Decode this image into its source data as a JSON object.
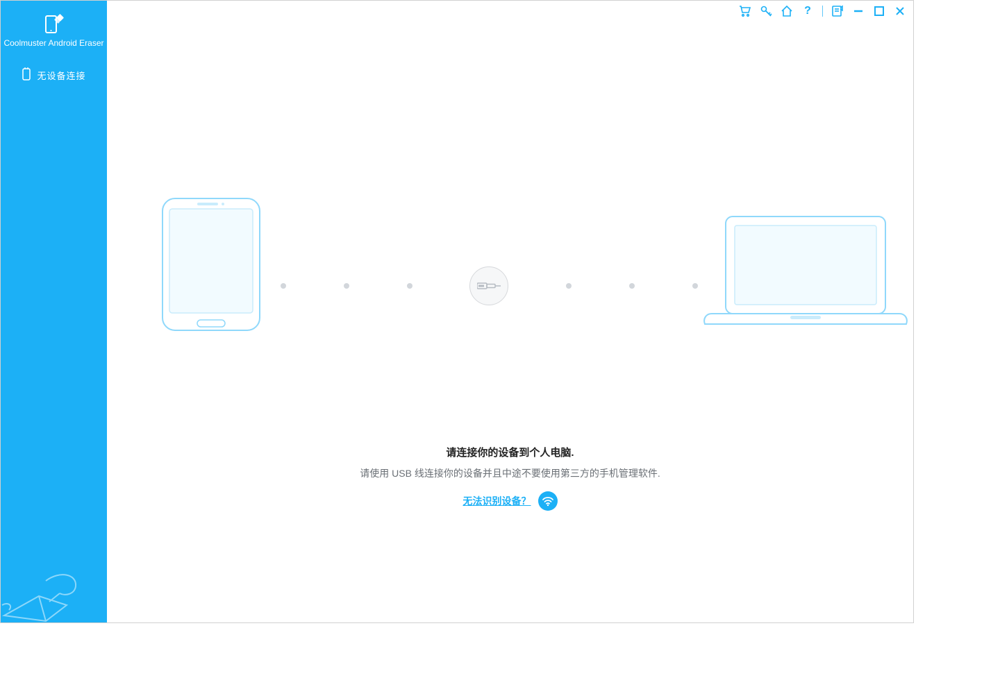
{
  "app": {
    "title": "Coolmuster Android Eraser"
  },
  "sidebar": {
    "device_status": "无设备连接"
  },
  "main": {
    "title": "请连接你的设备到个人电脑.",
    "subtitle": "请使用 USB 线连接你的设备并且中途不要使用第三方的手机管理软件.",
    "help_link": "无法识别设备？"
  },
  "icons": {
    "cart": "cart-icon",
    "key": "key-icon",
    "home": "home-icon",
    "help": "help-icon",
    "feedback": "feedback-icon",
    "minimize": "minimize-icon",
    "maximize": "maximize-icon",
    "close": "close-icon",
    "usb": "usb-connector-icon",
    "wifi": "wifi-icon",
    "phone_usb": "phone-usb-icon"
  },
  "colors": {
    "accent": "#1cb0f6",
    "text_muted": "#6a6f75",
    "dot": "#d2d6db"
  }
}
